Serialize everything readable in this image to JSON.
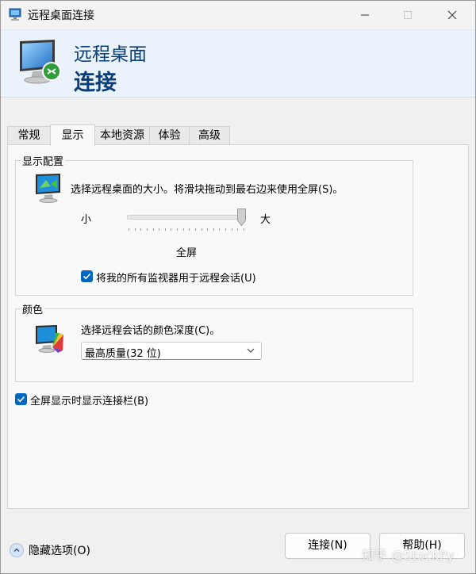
{
  "window": {
    "title": "远程桌面连接",
    "icon": "remote-desktop-icon"
  },
  "banner": {
    "line1": "远程桌面",
    "line2": "连接"
  },
  "tabs": [
    {
      "label": "常规",
      "active": false
    },
    {
      "label": "显示",
      "active": true
    },
    {
      "label": "本地资源",
      "active": false
    },
    {
      "label": "体验",
      "active": false
    },
    {
      "label": "高级",
      "active": false
    }
  ],
  "display_config": {
    "group_label": "显示配置",
    "description": "选择远程桌面的大小。将滑块拖动到最右边来使用全屏(S)。",
    "slider": {
      "min_label": "小",
      "max_label": "大",
      "value_label": "全屏",
      "position": 1.0
    },
    "all_monitors": {
      "label": "将我的所有监视器用于远程会话(U)",
      "checked": true
    }
  },
  "colors": {
    "group_label": "颜色",
    "description": "选择远程会话的颜色深度(C)。",
    "selected": "最高质量(32 位)"
  },
  "connection_bar": {
    "label": "全屏显示时显示连接栏(B)",
    "checked": true
  },
  "footer": {
    "hide_options": "隐藏选项(O)",
    "connect": "连接(N)",
    "help": "帮助(H)",
    "watermark": "知乎 @StockPy"
  },
  "accent": "#0067c0"
}
